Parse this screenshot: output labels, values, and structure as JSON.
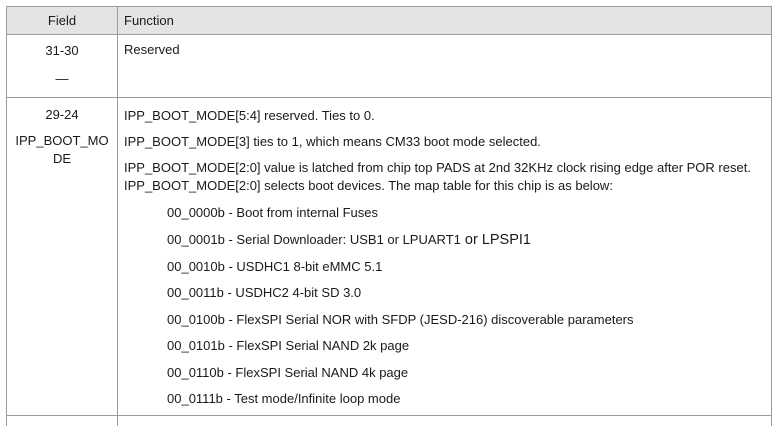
{
  "header": {
    "field": "Field",
    "function": "Function"
  },
  "rows": [
    {
      "field": "31-30",
      "field_sub": "—",
      "function": "Reserved"
    },
    {
      "field": "29-24",
      "field_name_1": "IPP_BOOT_MO",
      "field_name_2": "DE",
      "lines": [
        "IPP_BOOT_MODE[5:4] reserved. Ties to 0.",
        "IPP_BOOT_MODE[3] ties to 1, which means CM33 boot mode selected.",
        "IPP_BOOT_MODE[2:0] value is latched from chip top PADS at 2nd 32KHz clock rising edge after POR reset. IPP_BOOT_MODE[2:0] selects boot devices. The map table for this chip is as below:"
      ],
      "boot_modes": [
        "00_0000b - Boot from internal Fuses",
        "00_0001b - Serial Downloader: USB1 or LPUART1",
        "00_0010b - USDHC1 8-bit eMMC 5.1",
        "00_0011b - USDHC2 4-bit SD 3.0",
        "00_0100b - FlexSPI Serial NOR with SFDP (JESD-216) discoverable parameters",
        "00_0101b - FlexSPI Serial NAND 2k page",
        "00_0110b - FlexSPI Serial NAND 4k page",
        "00_0111b - Test mode/Infinite loop mode"
      ],
      "boot_mode_1_suffix": " or LPSPI1"
    }
  ]
}
